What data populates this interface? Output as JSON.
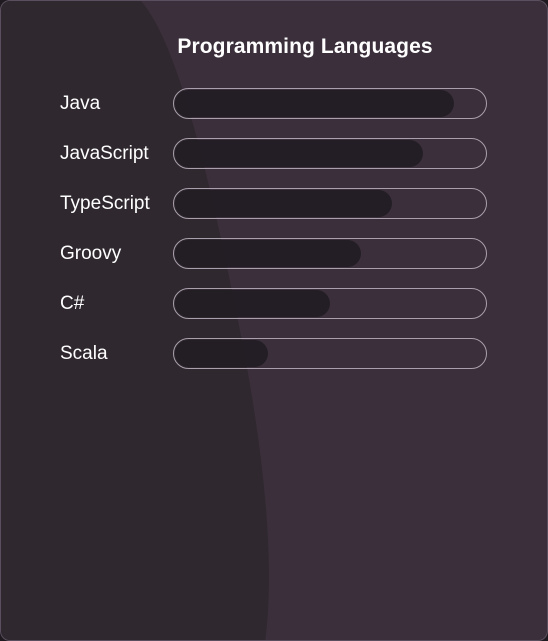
{
  "card": {
    "title": "Programming Languages"
  },
  "colors": {
    "card_bg": "#3a2f3b",
    "card_bg_dark": "#2f282f",
    "bar_fill": "#221d24",
    "bar_border": "#aaa0ad",
    "text": "#ffffff"
  },
  "skills": [
    {
      "label": "Java",
      "level": 0.9
    },
    {
      "label": "JavaScript",
      "level": 0.8
    },
    {
      "label": "TypeScript",
      "level": 0.7
    },
    {
      "label": "Groovy",
      "level": 0.6
    },
    {
      "label": "C#",
      "level": 0.5
    },
    {
      "label": "Scala",
      "level": 0.3
    }
  ]
}
